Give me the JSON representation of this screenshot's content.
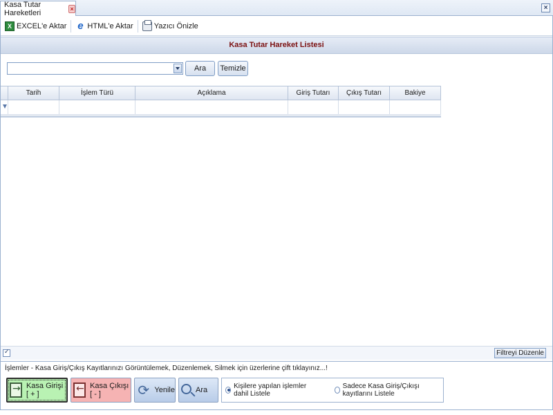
{
  "tab": {
    "title": "Kasa Tutar Hareketleri"
  },
  "toolbar": {
    "excel_label": "EXCEL'e Aktar",
    "html_label": "HTML'e Aktar",
    "print_label": "Yazıcı Önizle"
  },
  "list": {
    "title": "Kasa Tutar Hareket Listesi"
  },
  "search": {
    "value": "",
    "search_button": "Ara",
    "clear_button": "Temizle"
  },
  "grid": {
    "columns": [
      "Tarih",
      "İşlem Türü",
      "Açıklama",
      "Giriş Tutarı",
      "Çıkış Tutarı",
      "Bakiye"
    ]
  },
  "filter": {
    "edit_label": "Filtreyi Düzenle"
  },
  "info": {
    "text": "İşlemler - Kasa Giriş/Çıkış Kayıtlarınızı Görüntülemek, Düzenlemek, Silmek için üzerlerine çift tıklayınız...!"
  },
  "actions": {
    "cash_in": "Kasa Girişi [ + ]",
    "cash_out": "Kasa Çıkışı [ - ]",
    "refresh": "Yenile",
    "search": "Ara"
  },
  "options": {
    "include_persons": "Kişilere yapılan işlemler dahil Listele",
    "only_cash": "Sadece Kasa Giriş/Çıkışı kayıtlarını Listele",
    "selected": "include_persons"
  }
}
